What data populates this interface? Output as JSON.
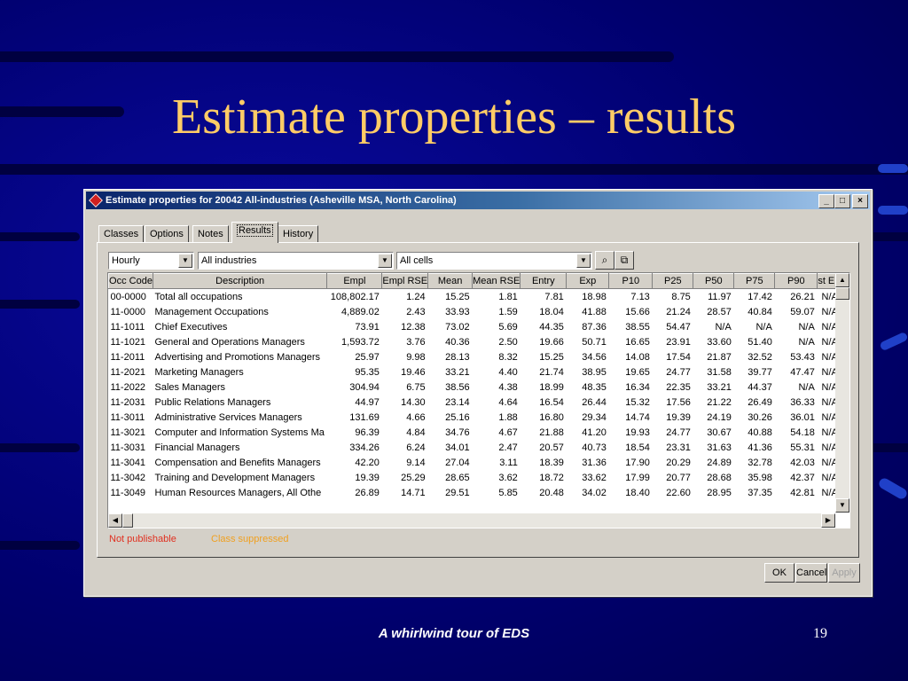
{
  "slide": {
    "title": "Estimate properties – results",
    "footer": "A whirlwind tour of EDS",
    "page_number": "19"
  },
  "window": {
    "title": "Estimate properties for 20042 All-industries (Asheville MSA, North Carolina)",
    "minimize": "_",
    "maximize": "□",
    "close": "×"
  },
  "tabs": [
    {
      "label": "Classes"
    },
    {
      "label": "Options"
    },
    {
      "label": "Notes"
    },
    {
      "label": "Results",
      "active": true
    },
    {
      "label": "History"
    }
  ],
  "filters": {
    "time_unit": "Hourly",
    "industry": "All industries",
    "cells": "All cells"
  },
  "grid": {
    "columns": [
      "Occ Code",
      "Description",
      "Empl",
      "Empl RSE",
      "Mean",
      "Mean RSE",
      "Entry",
      "Exp",
      "P10",
      "P25",
      "P50",
      "P75",
      "P90",
      "st En"
    ],
    "rows": [
      [
        "00-0000",
        "Total all occupations",
        "108,802.17",
        "1.24",
        "15.25",
        "1.81",
        "7.81",
        "18.98",
        "7.13",
        "8.75",
        "11.97",
        "17.42",
        "26.21",
        "N/A"
      ],
      [
        "11-0000",
        "Management Occupations",
        "4,889.02",
        "2.43",
        "33.93",
        "1.59",
        "18.04",
        "41.88",
        "15.66",
        "21.24",
        "28.57",
        "40.84",
        "59.07",
        "N/A"
      ],
      [
        "11-1011",
        "Chief Executives",
        "73.91",
        "12.38",
        "73.02",
        "5.69",
        "44.35",
        "87.36",
        "38.55",
        "54.47",
        "N/A",
        "N/A",
        "N/A",
        "N/A"
      ],
      [
        "11-1021",
        "General and Operations Managers",
        "1,593.72",
        "3.76",
        "40.36",
        "2.50",
        "19.66",
        "50.71",
        "16.65",
        "23.91",
        "33.60",
        "51.40",
        "N/A",
        "N/A"
      ],
      [
        "11-2011",
        "Advertising and Promotions Managers",
        "25.97",
        "9.98",
        "28.13",
        "8.32",
        "15.25",
        "34.56",
        "14.08",
        "17.54",
        "21.87",
        "32.52",
        "53.43",
        "N/A"
      ],
      [
        "11-2021",
        "Marketing Managers",
        "95.35",
        "19.46",
        "33.21",
        "4.40",
        "21.74",
        "38.95",
        "19.65",
        "24.77",
        "31.58",
        "39.77",
        "47.47",
        "N/A"
      ],
      [
        "11-2022",
        "Sales Managers",
        "304.94",
        "6.75",
        "38.56",
        "4.38",
        "18.99",
        "48.35",
        "16.34",
        "22.35",
        "33.21",
        "44.37",
        "N/A",
        "N/A"
      ],
      [
        "11-2031",
        "Public Relations Managers",
        "44.97",
        "14.30",
        "23.14",
        "4.64",
        "16.54",
        "26.44",
        "15.32",
        "17.56",
        "21.22",
        "26.49",
        "36.33",
        "N/A"
      ],
      [
        "11-3011",
        "Administrative Services Managers",
        "131.69",
        "4.66",
        "25.16",
        "1.88",
        "16.80",
        "29.34",
        "14.74",
        "19.39",
        "24.19",
        "30.26",
        "36.01",
        "N/A"
      ],
      [
        "11-3021",
        "Computer and Information Systems Ma",
        "96.39",
        "4.84",
        "34.76",
        "4.67",
        "21.88",
        "41.20",
        "19.93",
        "24.77",
        "30.67",
        "40.88",
        "54.18",
        "N/A"
      ],
      [
        "11-3031",
        "Financial Managers",
        "334.26",
        "6.24",
        "34.01",
        "2.47",
        "20.57",
        "40.73",
        "18.54",
        "23.31",
        "31.63",
        "41.36",
        "55.31",
        "N/A"
      ],
      [
        "11-3041",
        "Compensation and Benefits Managers",
        "42.20",
        "9.14",
        "27.04",
        "3.11",
        "18.39",
        "31.36",
        "17.90",
        "20.29",
        "24.89",
        "32.78",
        "42.03",
        "N/A"
      ],
      [
        "11-3042",
        "Training and Development Managers",
        "19.39",
        "25.29",
        "28.65",
        "3.62",
        "18.72",
        "33.62",
        "17.99",
        "20.77",
        "28.68",
        "35.98",
        "42.37",
        "N/A"
      ],
      [
        "11-3049",
        "Human Resources Managers, All Othe",
        "26.89",
        "14.71",
        "29.51",
        "5.85",
        "20.48",
        "34.02",
        "18.40",
        "22.60",
        "28.95",
        "37.35",
        "42.81",
        "N/A"
      ]
    ]
  },
  "legend": {
    "not_publishable": "Not publishable",
    "class_suppressed": "Class suppressed",
    "not_publishable_color": "#e03020",
    "class_suppressed_color": "#f0a020"
  },
  "buttons": {
    "ok": "OK",
    "cancel": "Cancel",
    "apply": "Apply"
  }
}
